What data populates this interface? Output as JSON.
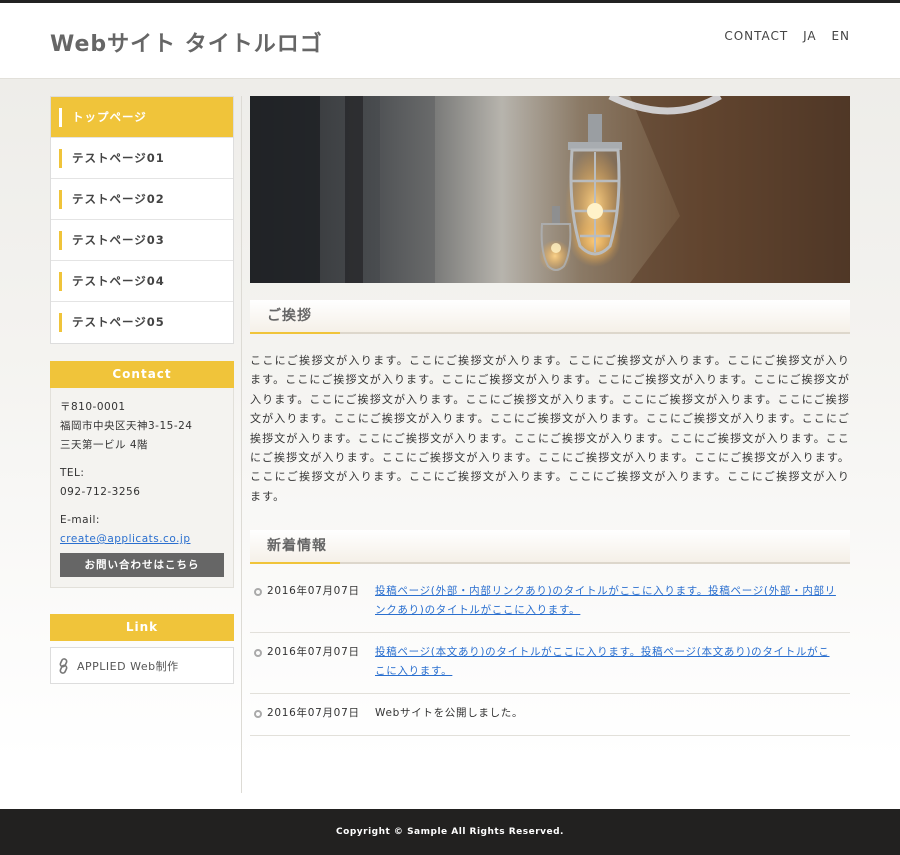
{
  "header": {
    "logo": "Webサイト タイトルロゴ",
    "nav": [
      "CONTACT",
      "JA",
      "EN"
    ]
  },
  "sidebar": {
    "menu": [
      {
        "label": "トップページ",
        "active": true
      },
      {
        "label": "テストページ01"
      },
      {
        "label": "テストページ02"
      },
      {
        "label": "テストページ03"
      },
      {
        "label": "テストページ04"
      },
      {
        "label": "テストページ05"
      }
    ],
    "contact": {
      "heading": "Contact",
      "postal": "〒810-0001",
      "address1": "福岡市中央区天神3-15-24",
      "address2": "三天第一ビル 4階",
      "tel_label": "TEL:",
      "tel": "092-712-3256",
      "email_label": "E-mail:",
      "email": "create@applicats.co.jp",
      "button": "お問い合わせはこちら"
    },
    "link": {
      "heading": "Link",
      "item": "APPLIED Web制作",
      "icon": "link-icon"
    }
  },
  "main": {
    "greeting_heading": "ご挨拶",
    "greeting_text": "ここにご挨拶文が入ります。ここにご挨拶文が入ります。ここにご挨拶文が入ります。ここにご挨拶文が入ります。ここにご挨拶文が入ります。ここにご挨拶文が入ります。ここにご挨拶文が入ります。ここにご挨拶文が入ります。ここにご挨拶文が入ります。ここにご挨拶文が入ります。ここにご挨拶文が入ります。ここにご挨拶文が入ります。ここにご挨拶文が入ります。ここにご挨拶文が入ります。ここにご挨拶文が入ります。ここにご挨拶文が入ります。ここにご挨拶文が入ります。ここにご挨拶文が入ります。ここにご挨拶文が入ります。ここにご挨拶文が入ります。ここにご挨拶文が入ります。ここにご挨拶文が入ります。ここにご挨拶文が入ります。ここにご挨拶文が入ります。ここにご挨拶文が入ります。ここにご挨拶文が入ります。ここにご挨拶文が入ります。",
    "news_heading": "新着情報",
    "news": [
      {
        "date": "2016年07月07日",
        "title": "投稿ページ(外部・内部リンクあり)のタイトルがここに入ります。投稿ページ(外部・内部リンクあり)のタイトルがここに入ります。",
        "link": true
      },
      {
        "date": "2016年07月07日",
        "title": "投稿ページ(本文あり)のタイトルがここに入ります。投稿ページ(本文あり)のタイトルがここに入ります。",
        "link": true
      },
      {
        "date": "2016年07月07日",
        "title": "Webサイトを公開しました。",
        "link": false
      }
    ]
  },
  "footer": {
    "copyright": "Copyright © Sample All Rights Reserved."
  },
  "colors": {
    "accent": "#f0c43a",
    "link": "#2a6fcf",
    "footer": "#222120"
  }
}
